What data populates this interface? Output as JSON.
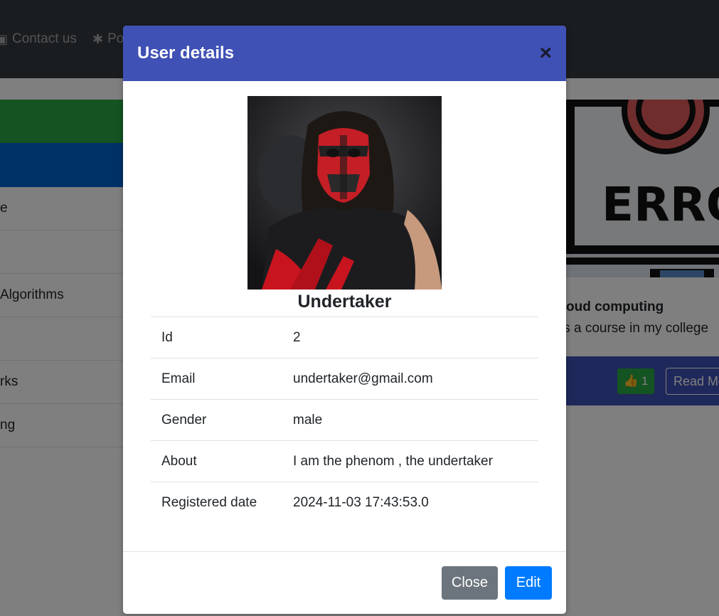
{
  "navbar": {
    "contact_label": "Contact us",
    "partial_label": "Po"
  },
  "sidebar": {
    "items": [
      {
        "label": ""
      },
      {
        "label": ""
      },
      {
        "label": "e"
      },
      {
        "label": ""
      },
      {
        "label": " Algorithms"
      },
      {
        "label": ""
      },
      {
        "label": "rks"
      },
      {
        "label": "ng"
      }
    ]
  },
  "card": {
    "image_text": "ERRO",
    "title": "oud computing",
    "text": "is a course in my college",
    "like_count": "1",
    "read_more_label": "Read Mo"
  },
  "modal": {
    "title": "User details",
    "close_symbol": "×",
    "user_name": "Undertaker",
    "rows": [
      {
        "key": "Id",
        "value": "2"
      },
      {
        "key": "Email",
        "value": "undertaker@gmail.com"
      },
      {
        "key": "Gender",
        "value": "male"
      },
      {
        "key": "About",
        "value": "I am the phenom , the undertaker"
      },
      {
        "key": "Registered date",
        "value": "2024-11-03 17:43:53.0"
      }
    ],
    "close_label": "Close",
    "edit_label": "Edit"
  },
  "colors": {
    "navbar": "#343a40",
    "modal_header": "#3f51b5",
    "success": "#28a745",
    "primary": "#007bff",
    "secondary": "#6c757d"
  }
}
